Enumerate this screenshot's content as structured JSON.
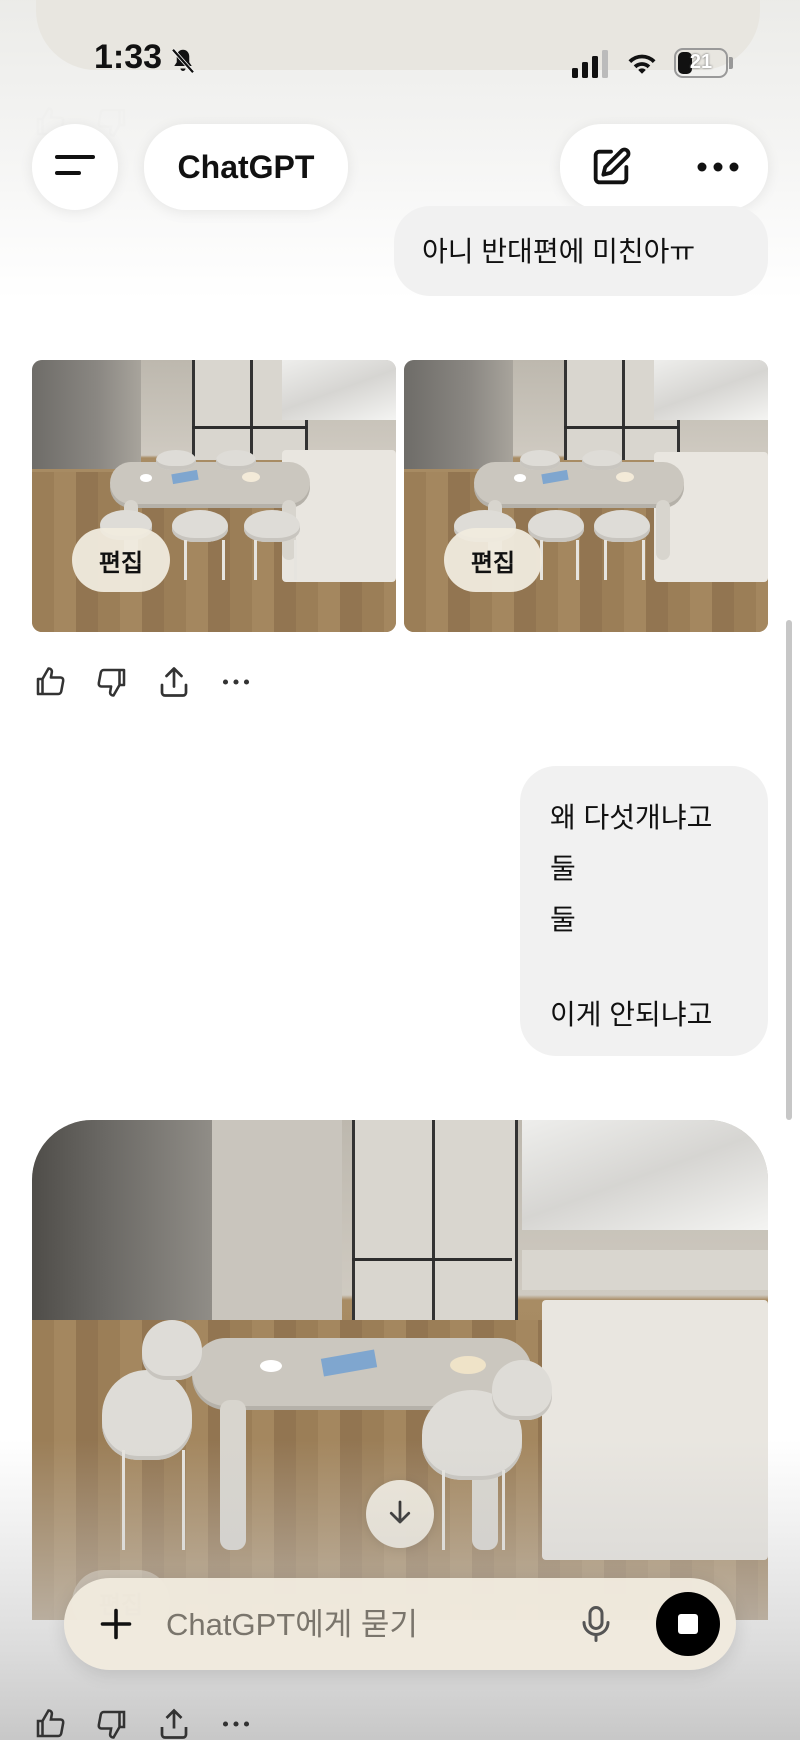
{
  "status_bar": {
    "time": "1:33",
    "battery": "21"
  },
  "header": {
    "title": "ChatGPT"
  },
  "messages": {
    "user_1": "아니 반대편에 미친아ㅠ",
    "user_2_lines": [
      "왜 다섯개냐고",
      "둘",
      "둘",
      "",
      "이게 안되냐고"
    ]
  },
  "images": {
    "edit_label": "편집"
  },
  "composer": {
    "placeholder": "ChatGPT에게 묻기"
  },
  "icons": {
    "menu": "menu-icon",
    "new_chat": "compose-icon",
    "more": "more-icon",
    "thumbs_up": "thumbs-up-icon",
    "thumbs_down": "thumbs-down-icon",
    "share": "share-icon",
    "options": "ellipsis-icon",
    "scroll_down": "arrow-down-icon",
    "plus": "plus-icon",
    "mic": "microphone-icon",
    "stop": "stop-icon"
  }
}
